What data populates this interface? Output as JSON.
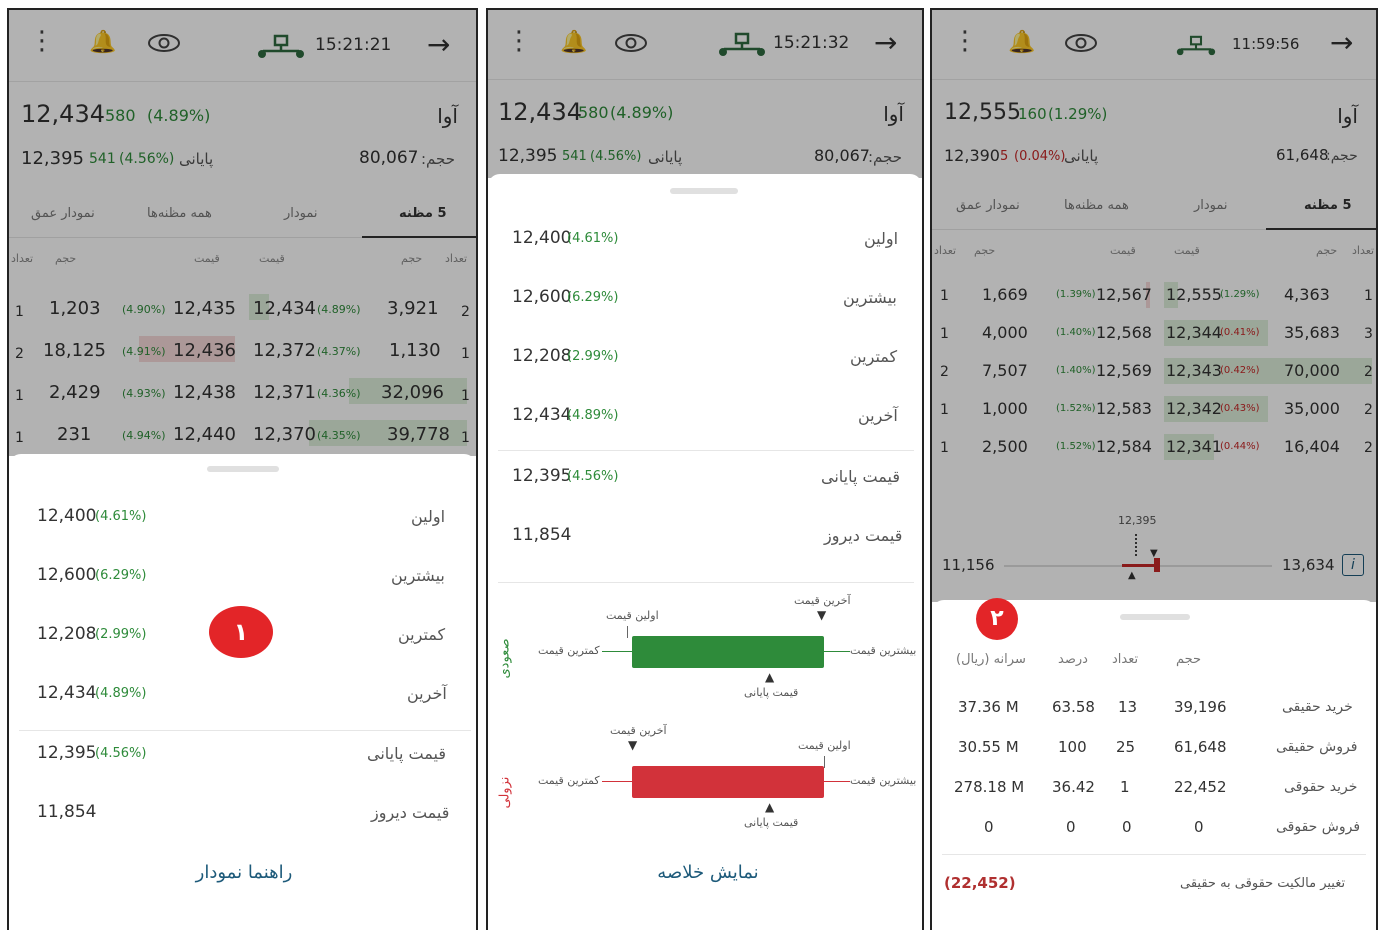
{
  "p1": {
    "time": "15:21:21",
    "symbol": "آوا",
    "last_price": "12,434",
    "last_change": "580",
    "last_pct": "(4.89%)",
    "close_price": "12,395",
    "close_change": "541",
    "close_pct": "(4.56%)",
    "close_label": "پایانی",
    "volume_label": "حجم:",
    "volume": "80,067",
    "tabs": [
      "5 مظنه",
      "نمودار",
      "همه مظنه‌ها",
      "نمودار عمق"
    ],
    "headers": [
      "تعداد",
      "حجم",
      "قیمت",
      "قیمت",
      "حجم",
      "تعداد"
    ],
    "rows": [
      {
        "bcnt": "1",
        "bvol": "1,203",
        "bpct": "(4.90%)",
        "bprice": "12,435",
        "sprice": "12,434",
        "spct": "(4.89%)",
        "svol": "3,921",
        "scnt": "2"
      },
      {
        "bcnt": "2",
        "bvol": "18,125",
        "bpct": "(4.91%)",
        "bprice": "12,436",
        "sprice": "12,372",
        "spct": "(4.37%)",
        "svol": "1,130",
        "scnt": "1"
      },
      {
        "bcnt": "1",
        "bvol": "2,429",
        "bpct": "(4.93%)",
        "bprice": "12,438",
        "sprice": "12,371",
        "spct": "(4.36%)",
        "svol": "32,096",
        "scnt": "1"
      },
      {
        "bcnt": "1",
        "bvol": "231",
        "bpct": "(4.94%)",
        "bprice": "12,440",
        "sprice": "12,370",
        "spct": "(4.35%)",
        "svol": "39,778",
        "scnt": "1"
      }
    ],
    "sheet": [
      {
        "label": "اولین",
        "value": "12,400",
        "pct": "(4.61%)"
      },
      {
        "label": "بیشترین",
        "value": "12,600",
        "pct": "(6.29%)"
      },
      {
        "label": "کمترین",
        "value": "12,208",
        "pct": "(2.99%)"
      },
      {
        "label": "آخرین",
        "value": "12,434",
        "pct": "(4.89%)"
      },
      {
        "label": "قیمت پایانی",
        "value": "12,395",
        "pct": "(4.56%)"
      },
      {
        "label": "قیمت دیروز",
        "value": "11,854",
        "pct": ""
      }
    ],
    "badge": "۱",
    "link": "راهنما نمودار"
  },
  "p2": {
    "time": "15:21:32",
    "symbol": "آوا",
    "last_price": "12,434",
    "last_change": "580",
    "last_pct": "(4.89%)",
    "close_price": "12,395",
    "close_change": "541",
    "close_pct": "(4.56%)",
    "close_label": "پایانی",
    "volume_label": "حجم:",
    "volume": "80,067",
    "sheet": [
      {
        "label": "اولین",
        "value": "12,400",
        "pct": "(4.61%)"
      },
      {
        "label": "بیشترین",
        "value": "12,600",
        "pct": "(6.29%)"
      },
      {
        "label": "کمترین",
        "value": "12,208",
        "pct": "(2.99%)"
      },
      {
        "label": "آخرین",
        "value": "12,434",
        "pct": "(4.89%)"
      },
      {
        "label": "قیمت پایانی",
        "value": "12,395",
        "pct": "(4.56%)"
      },
      {
        "label": "قیمت دیروز",
        "value": "11,854",
        "pct": ""
      }
    ],
    "up_label": "صعودی",
    "down_label": "نزولی",
    "up": {
      "last": "آخرین قیمت",
      "first": "اولین قیمت",
      "min": "کمترین قیمت",
      "max": "بیشترین قیمت",
      "close": "قیمت پایانی"
    },
    "down": {
      "last": "آخرین قیمت",
      "first": "اولین قیمت",
      "min": "کمترین قیمت",
      "max": "بیشترین قیمت",
      "close": "قیمت پایانی"
    },
    "link": "نمایش خلاصه",
    "colors": {
      "up": "#2e8b3a",
      "down": "#d2323a"
    }
  },
  "p3": {
    "time": "11:59:56",
    "symbol": "آوا",
    "last_price": "12,555",
    "last_change": "160",
    "last_pct": "(1.29%)",
    "close_price": "12,390",
    "close_change": "5",
    "close_pct": "(0.04%)",
    "close_label": "پایانی",
    "volume_label": "حجم:",
    "volume": "61,648",
    "tabs": [
      "5 مظنه",
      "نمودار",
      "همه مظنه‌ها",
      "نمودار عمق"
    ],
    "headers": [
      "تعداد",
      "حجم",
      "قیمت",
      "قیمت",
      "حجم",
      "تعداد"
    ],
    "rows": [
      {
        "bcnt": "1",
        "bvol": "1,669",
        "bpct": "(1.39%)",
        "bprice": "12,567",
        "sprice": "12,555",
        "spct": "(1.29%)",
        "svol": "4,363",
        "scnt": "1"
      },
      {
        "bcnt": "1",
        "bvol": "4,000",
        "bpct": "(1.40%)",
        "bprice": "12,568",
        "sprice": "12,344",
        "spct": "(0.41%)",
        "svol": "35,683",
        "scnt": "3"
      },
      {
        "bcnt": "2",
        "bvol": "7,507",
        "bpct": "(1.40%)",
        "bprice": "12,569",
        "sprice": "12,343",
        "spct": "(0.42%)",
        "svol": "70,000",
        "scnt": "2"
      },
      {
        "bcnt": "1",
        "bvol": "1,000",
        "bpct": "(1.52%)",
        "bprice": "12,583",
        "sprice": "12,342",
        "spct": "(0.43%)",
        "svol": "35,000",
        "scnt": "2"
      },
      {
        "bcnt": "1",
        "bvol": "2,500",
        "bpct": "(1.52%)",
        "bprice": "12,584",
        "sprice": "12,341",
        "spct": "(0.44%)",
        "svol": "16,404",
        "scnt": "2"
      }
    ],
    "range_min": "11,156",
    "range_max": "13,634",
    "range_mid": "12,395",
    "badge": "۲",
    "table_headers": [
      "حجم",
      "تعداد",
      "درصد",
      "سرانه (ریال)"
    ],
    "table_rows": [
      {
        "label": "خرید حقیقی",
        "vol": "39,196",
        "cnt": "13",
        "pct": "63.58",
        "per": "37.36 M"
      },
      {
        "label": "فروش حقیقی",
        "vol": "61,648",
        "cnt": "25",
        "pct": "100",
        "per": "30.55 M"
      },
      {
        "label": "خرید حقوقی",
        "vol": "22,452",
        "cnt": "1",
        "pct": "36.42",
        "per": "278.18 M"
      },
      {
        "label": "فروش حقوقی",
        "vol": "0",
        "cnt": "0",
        "pct": "0",
        "per": "0"
      }
    ],
    "ownership_label": "تغییر مالکیت حقوقی به حقیقی",
    "ownership_value": "(22,452)"
  }
}
